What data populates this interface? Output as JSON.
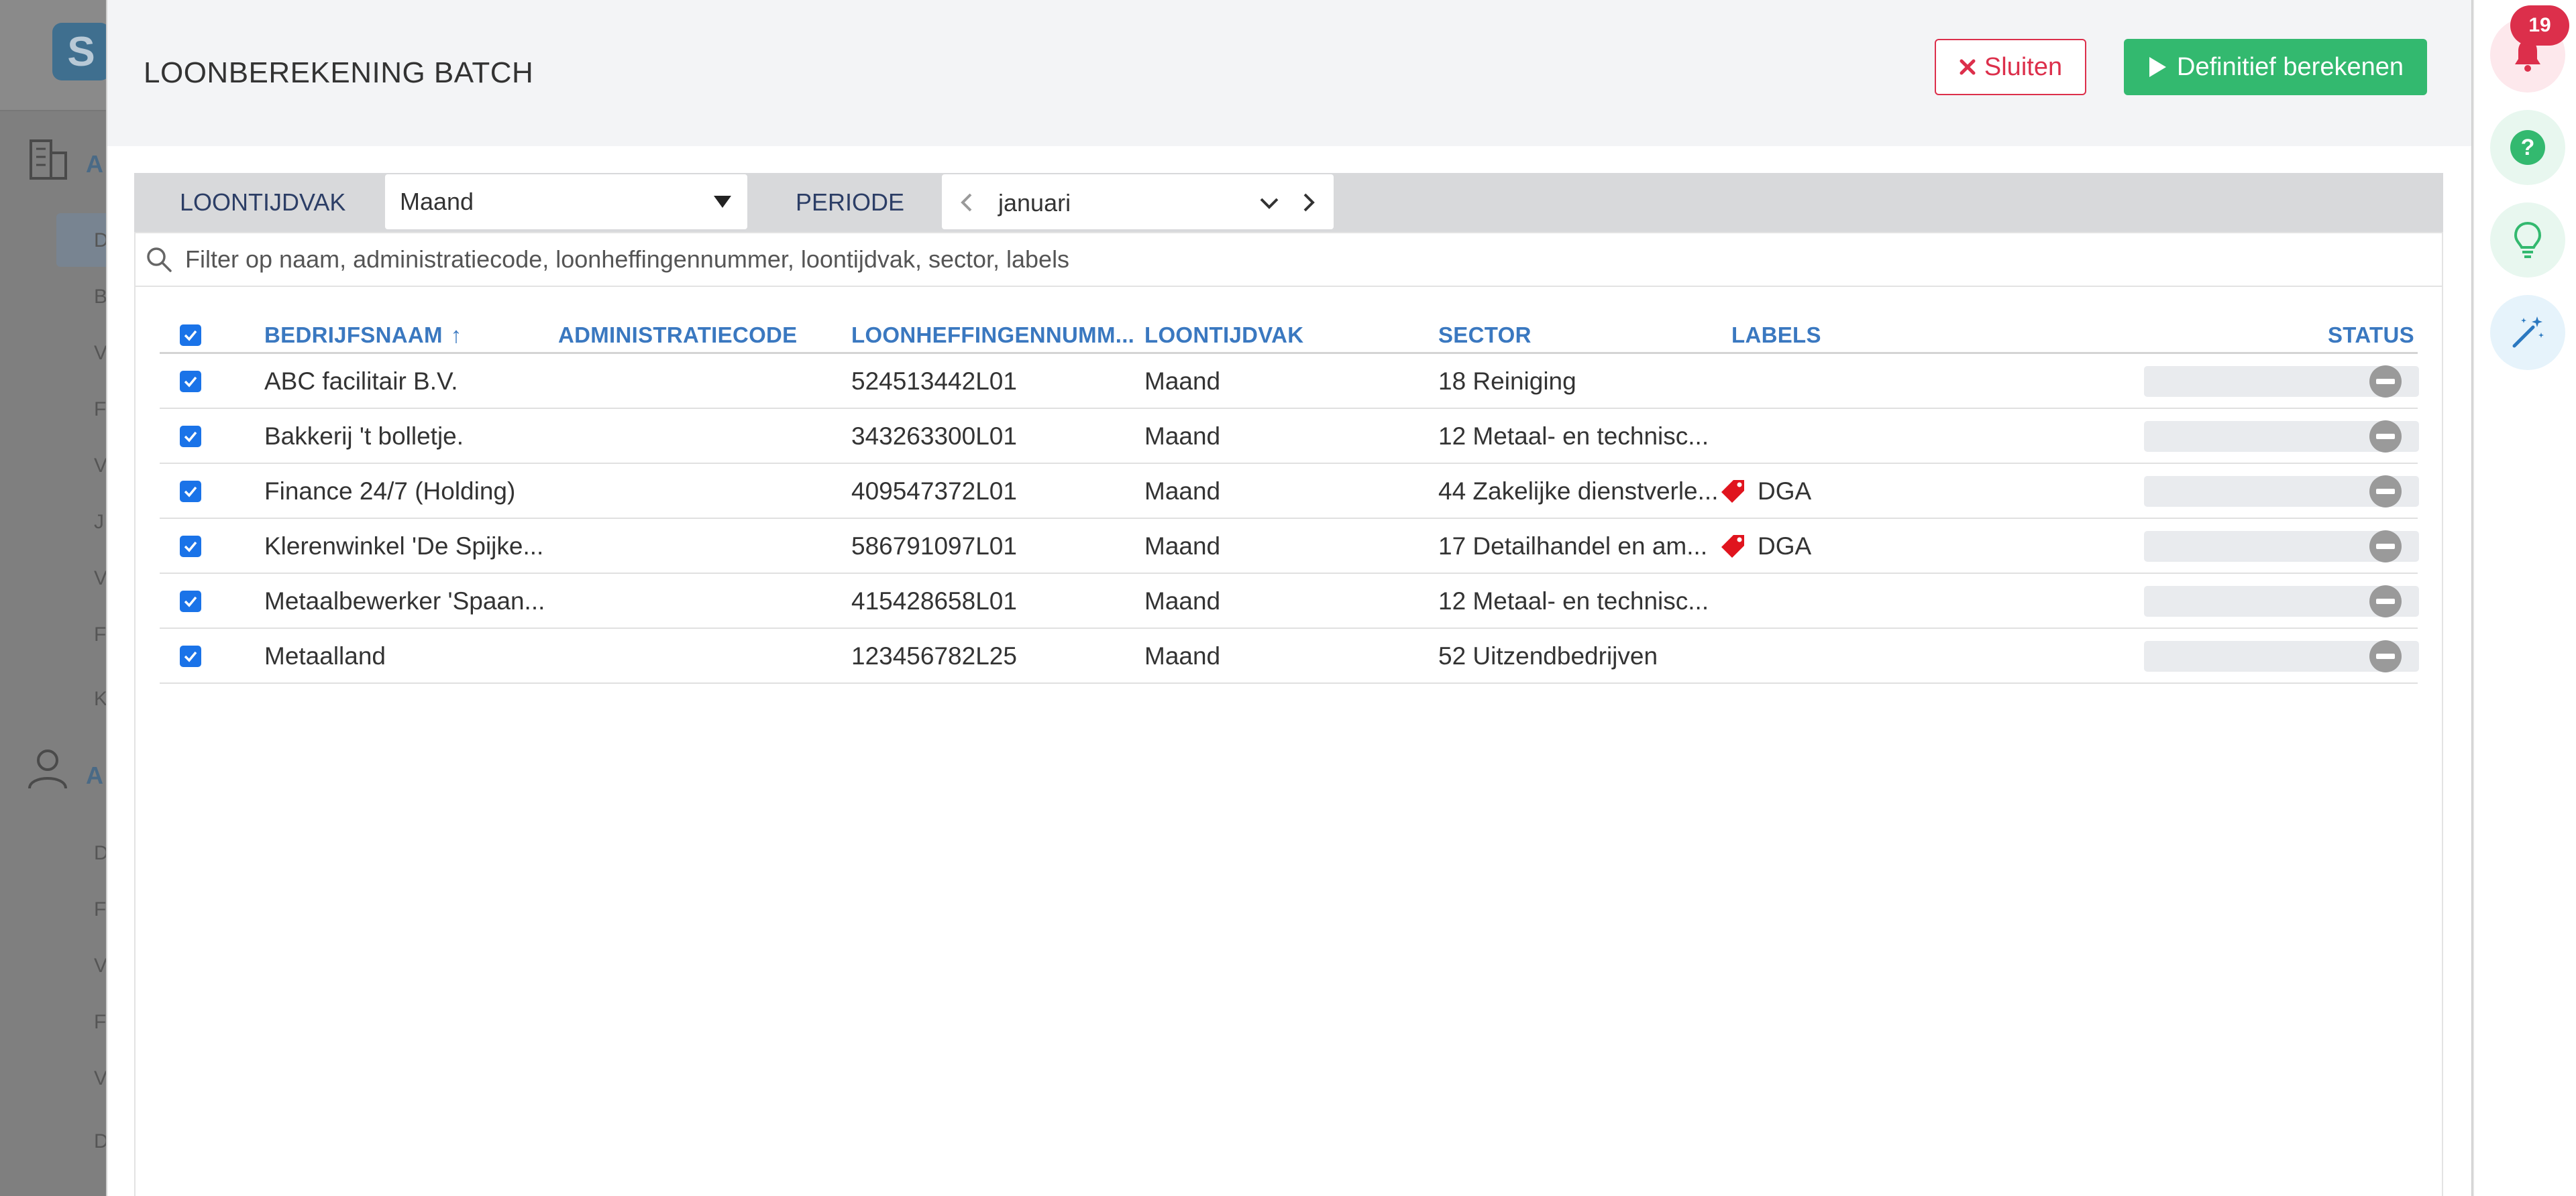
{
  "background": {
    "logo_letter": "S",
    "nav_letters": [
      "A",
      "A"
    ],
    "sub_letters": [
      "D",
      "B",
      "V",
      "F",
      "V",
      "J",
      "V",
      "F",
      "K",
      "D",
      "F",
      "V",
      "F",
      "V",
      "D"
    ]
  },
  "modal": {
    "title": "LOONBEREKENING BATCH",
    "close_label": "Sluiten",
    "calculate_label": "Definitief berekenen"
  },
  "filters": {
    "loontijdvak_label": "LOONTIJDVAK",
    "loontijdvak_value": "Maand",
    "periode_label": "PERIODE",
    "periode_value": "januari"
  },
  "search": {
    "placeholder": "Filter op naam, administratiecode, loonheffingennummer, loontijdvak, sector, labels"
  },
  "table": {
    "headers": {
      "bedrijfsnaam": "BEDRIJFSNAAM",
      "sort_indicator": "↑",
      "administratiecode": "ADMINISTRATIECODE",
      "loonheffingennummer": "LOONHEFFINGENNUMM...",
      "loontijdvak": "LOONTIJDVAK",
      "sector": "SECTOR",
      "labels": "LABELS",
      "status": "STATUS"
    },
    "rows": [
      {
        "name": "ABC facilitair B.V.",
        "admin": "",
        "lhn": "524513442L01",
        "ltv": "Maand",
        "sector": "18 Reiniging",
        "label": ""
      },
      {
        "name": "Bakkerij 't bolletje.",
        "admin": "",
        "lhn": "343263300L01",
        "ltv": "Maand",
        "sector": "12 Metaal- en technisc...",
        "label": ""
      },
      {
        "name": "Finance 24/7 (Holding)",
        "admin": "",
        "lhn": "409547372L01",
        "ltv": "Maand",
        "sector": "44 Zakelijke dienstverle...",
        "label": "DGA"
      },
      {
        "name": "Klerenwinkel 'De Spijke...",
        "admin": "",
        "lhn": "586791097L01",
        "ltv": "Maand",
        "sector": "17 Detailhandel en am...",
        "label": "DGA"
      },
      {
        "name": "Metaalbewerker 'Spaan...",
        "admin": "",
        "lhn": "415428658L01",
        "ltv": "Maand",
        "sector": "12 Metaal- en technisc...",
        "label": ""
      },
      {
        "name": "Metaalland",
        "admin": "",
        "lhn": "123456782L25",
        "ltv": "Maand",
        "sector": "52 Uitzendbedrijven",
        "label": ""
      }
    ]
  },
  "rail": {
    "notification_count": "19"
  },
  "colors": {
    "accent_blue": "#3a78c0",
    "danger": "#dc2f4b",
    "success": "#33b96f",
    "checkbox": "#1a73e8",
    "tag_red": "#e0141e"
  }
}
